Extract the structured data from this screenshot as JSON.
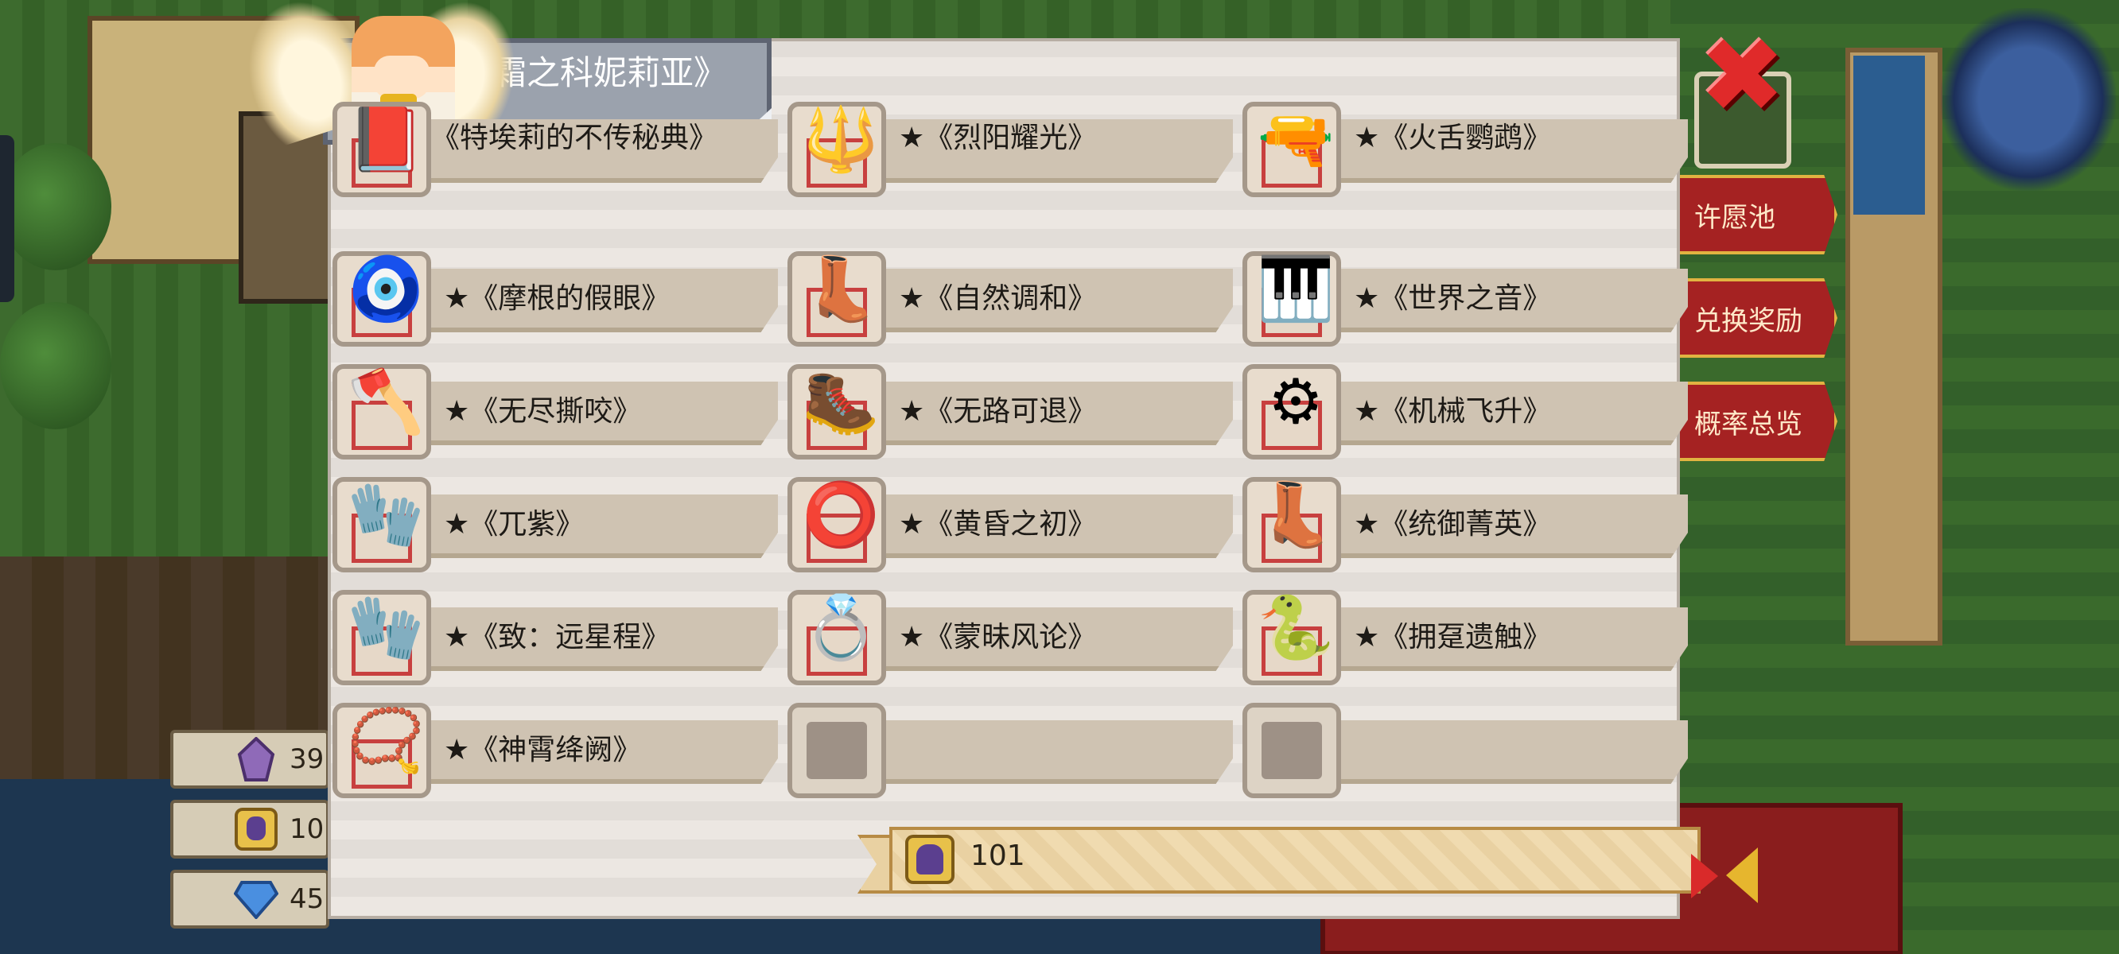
{
  "dialog": {
    "title": "《霜之科妮莉亚》",
    "title_visible": "霜之科妮莉亚》"
  },
  "items": [
    {
      "name": "《特埃莉的不传秘典》",
      "icon": "tome-icon",
      "glyph": "📕"
    },
    {
      "name": "★《烈阳耀光》",
      "icon": "spear-icon",
      "glyph": "🔱"
    },
    {
      "name": "★《火舌鹦鹉》",
      "icon": "parrot-gun-icon",
      "glyph": "🔫"
    },
    {
      "name": "★《摩根的假眼》",
      "icon": "eye-pendant-icon",
      "glyph": "🧿"
    },
    {
      "name": "★《自然调和》",
      "icon": "winged-boots-icon",
      "glyph": "👢"
    },
    {
      "name": "★《世界之音》",
      "icon": "piano-icon",
      "glyph": "🎹"
    },
    {
      "name": "★《无尽撕咬》",
      "icon": "ice-axe-icon",
      "glyph": "🪓"
    },
    {
      "name": "★《无路可退》",
      "icon": "armored-boot-icon",
      "glyph": "🥾"
    },
    {
      "name": "★《机械飞升》",
      "icon": "mech-wing-icon",
      "glyph": "⚙"
    },
    {
      "name": "★《兀紫》",
      "icon": "crystal-gauntlet-icon",
      "glyph": "🧤"
    },
    {
      "name": "★《黄昏之初》",
      "icon": "collar-icon",
      "glyph": "⭕"
    },
    {
      "name": "★《统御菁英》",
      "icon": "red-boot-icon",
      "glyph": "👢"
    },
    {
      "name": "★《致：远星程》",
      "icon": "gold-gauntlet-icon",
      "glyph": "🧤"
    },
    {
      "name": "★《蒙昧风论》",
      "icon": "gold-ring-icon",
      "glyph": "💍"
    },
    {
      "name": "★《拥趸遗触》",
      "icon": "serpent-staff-icon",
      "glyph": "🐍"
    },
    {
      "name": "★《神霄绛阙》",
      "icon": "amulet-icon",
      "glyph": "📿"
    },
    {
      "name": "",
      "icon": "empty-slot",
      "glyph": ""
    },
    {
      "name": "",
      "icon": "empty-slot",
      "glyph": ""
    }
  ],
  "counter": {
    "value": "101",
    "icon": "ticket-token-icon"
  },
  "currencies": [
    {
      "value": "39",
      "icon": "purple-crystal-icon"
    },
    {
      "value": "10",
      "icon": "ticket-token-icon"
    },
    {
      "value": "45",
      "icon": "blue-gem-icon"
    }
  ],
  "side_menu": [
    {
      "label": "许愿池",
      "visible": "许愿池"
    },
    {
      "label": "兑换奖励",
      "visible": "兑换奖励"
    },
    {
      "label": "概率总览",
      "visible": "概率总览"
    }
  ],
  "colors": {
    "close_red": "#e02a2a",
    "slot_border_red": "#c8403f",
    "menu_red": "#a52222",
    "menu_gold": "#e1b341"
  }
}
